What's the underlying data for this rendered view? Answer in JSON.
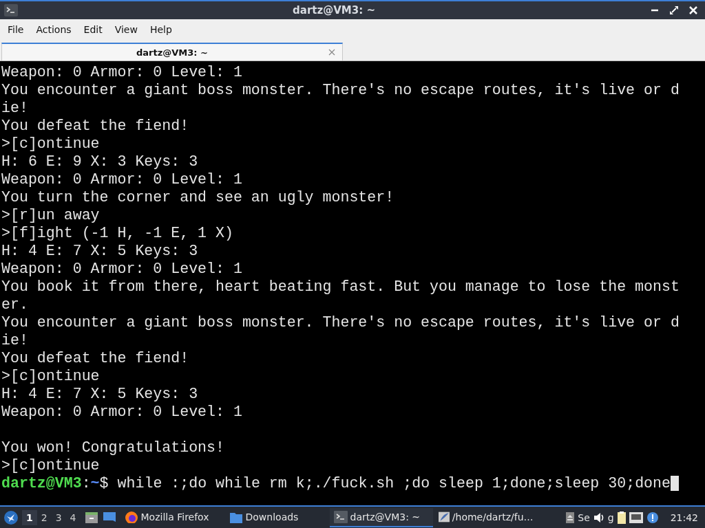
{
  "window": {
    "title": "dartz@VM3: ~"
  },
  "menu": [
    "File",
    "Actions",
    "Edit",
    "View",
    "Help"
  ],
  "tabs": [
    {
      "label": "dartz@VM3: ~",
      "selected": true
    }
  ],
  "terminal": {
    "lines": [
      {
        "kind": "text",
        "text": "Weapon: 0 Armor: 0 Level: 1"
      },
      {
        "kind": "text",
        "text": "You encounter a giant boss monster. There's no escape routes, it's live or d"
      },
      {
        "kind": "text",
        "text": "ie!"
      },
      {
        "kind": "text",
        "text": "You defeat the fiend!"
      },
      {
        "kind": "text",
        "text": ">[c]ontinue"
      },
      {
        "kind": "text",
        "text": "H: 6 E: 9 X: 3 Keys: 3"
      },
      {
        "kind": "text",
        "text": "Weapon: 0 Armor: 0 Level: 1"
      },
      {
        "kind": "text",
        "text": "You turn the corner and see an ugly monster!"
      },
      {
        "kind": "text",
        "text": ">[r]un away"
      },
      {
        "kind": "text",
        "text": ">[f]ight (-1 H, -1 E, 1 X)"
      },
      {
        "kind": "text",
        "text": "H: 4 E: 7 X: 5 Keys: 3"
      },
      {
        "kind": "text",
        "text": "Weapon: 0 Armor: 0 Level: 1"
      },
      {
        "kind": "text",
        "text": "You book it from there, heart beating fast. But you manage to lose the monst"
      },
      {
        "kind": "text",
        "text": "er."
      },
      {
        "kind": "text",
        "text": "You encounter a giant boss monster. There's no escape routes, it's live or d"
      },
      {
        "kind": "text",
        "text": "ie!"
      },
      {
        "kind": "text",
        "text": "You defeat the fiend!"
      },
      {
        "kind": "text",
        "text": ">[c]ontinue"
      },
      {
        "kind": "text",
        "text": "H: 4 E: 7 X: 5 Keys: 3"
      },
      {
        "kind": "text",
        "text": "Weapon: 0 Armor: 0 Level: 1"
      },
      {
        "kind": "blank"
      },
      {
        "kind": "text",
        "text": "You won! Congratulations!"
      },
      {
        "kind": "text",
        "text": ">[c]ontinue"
      }
    ],
    "prompt": {
      "user_host": "dartz@VM3",
      "separator": ":",
      "path": "~",
      "symbol": "$",
      "command": "while :;do while rm k;./fuck.sh ;do sleep 1;done;sleep 30;done"
    }
  },
  "taskbar": {
    "workspaces": [
      {
        "label": "1",
        "selected": true
      },
      {
        "label": "2",
        "selected": false
      },
      {
        "label": "3",
        "selected": false
      },
      {
        "label": "4",
        "selected": false
      }
    ],
    "tasks": [
      {
        "kind": "firefox",
        "label": "Mozilla Firefox",
        "selected": false
      },
      {
        "kind": "folder",
        "label": "Downloads",
        "selected": false
      },
      {
        "kind": "terminal",
        "label": "dartz@VM3: ~",
        "selected": true
      },
      {
        "kind": "editor",
        "label": "/home/dartz/fu…",
        "selected": false
      }
    ],
    "tray": [
      "Se",
      "g"
    ],
    "clock": "21:42"
  }
}
